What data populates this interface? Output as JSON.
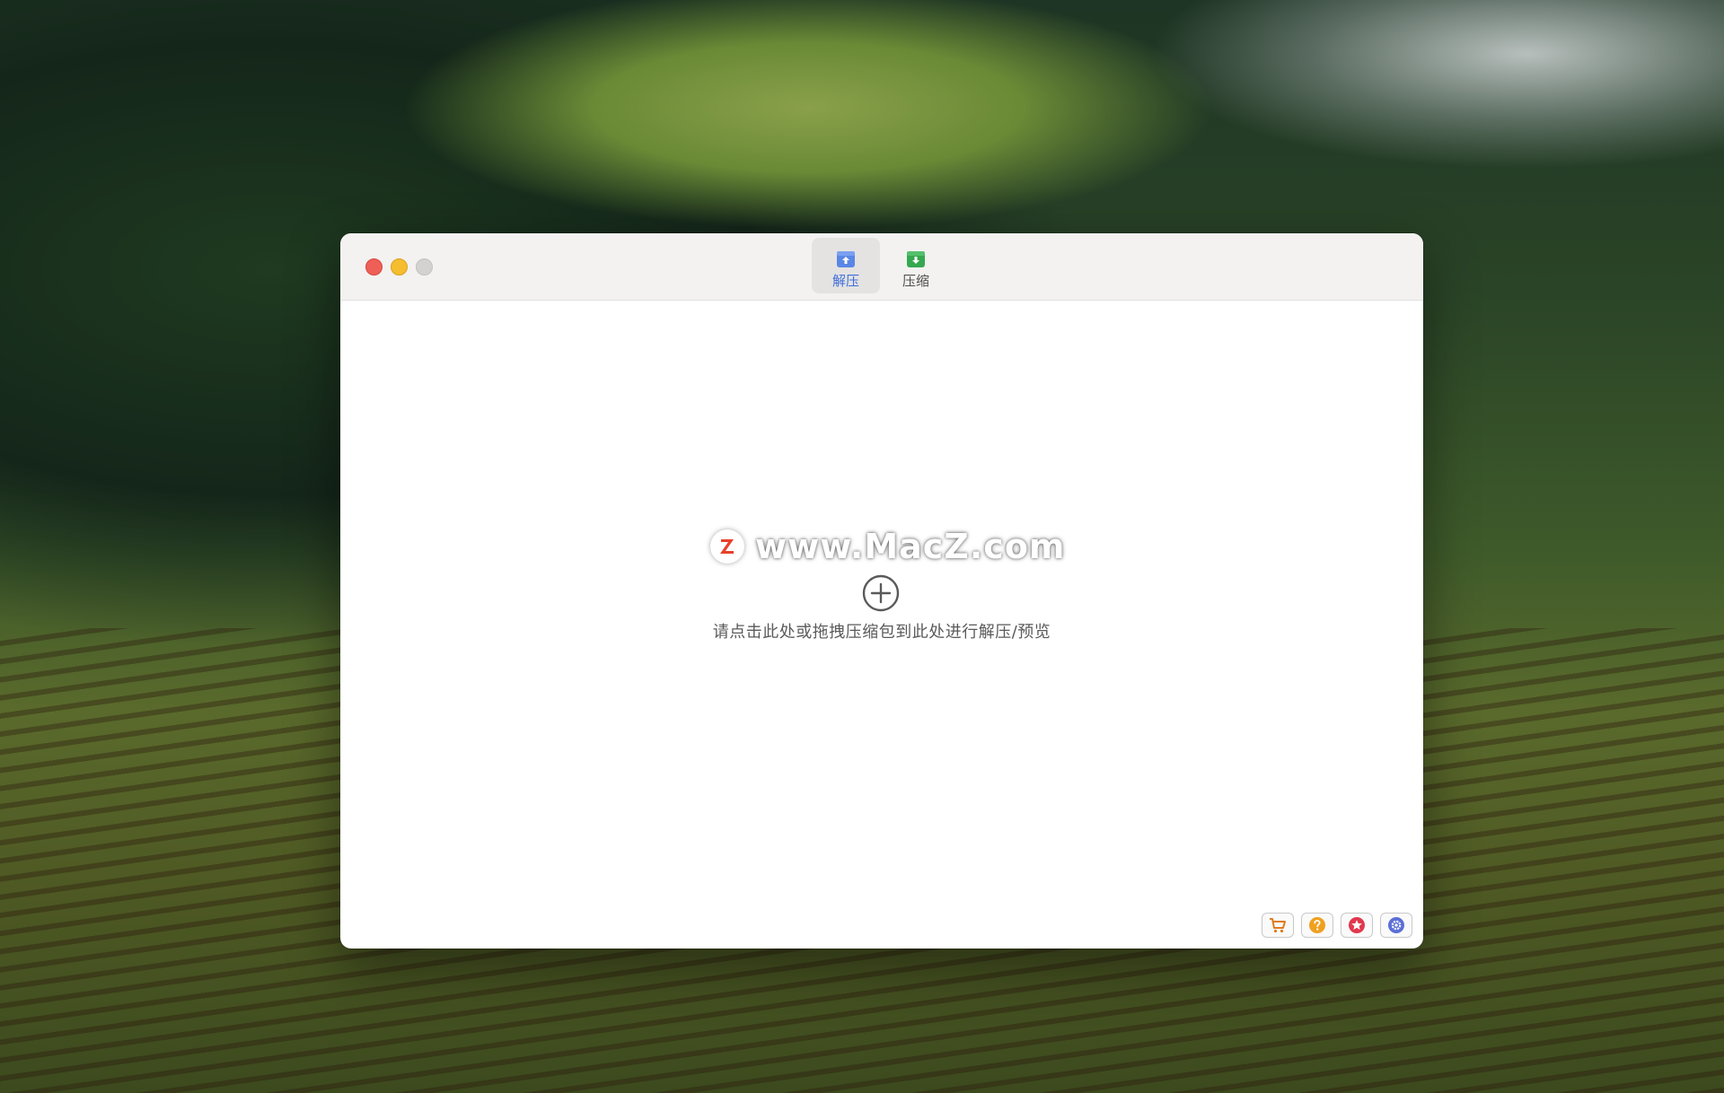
{
  "window": {
    "tabs": [
      {
        "label": "解压",
        "icon": "archive-upload-icon",
        "active": true,
        "color": "#3f6ed8"
      },
      {
        "label": "压缩",
        "icon": "archive-download-icon",
        "active": false,
        "color": "#2f9e44"
      }
    ]
  },
  "content": {
    "watermark": "www.MacZ.com",
    "watermark_logo": "Z",
    "hint": "请点击此处或拖拽压缩包到此处进行解压/预览",
    "add_icon": "plus-circle-icon"
  },
  "footer": {
    "buttons": [
      {
        "name": "cart-icon",
        "color": "#e07b1f"
      },
      {
        "name": "help-icon",
        "color": "#f0a020"
      },
      {
        "name": "star-icon",
        "color": "#e0384e"
      },
      {
        "name": "gear-icon",
        "color": "#5b6fd8"
      }
    ]
  },
  "colors": {
    "close": "#ee5f57",
    "minimize": "#f5bd2f",
    "maximize": "#d3d2d1",
    "accent": "#3f6ed8"
  }
}
